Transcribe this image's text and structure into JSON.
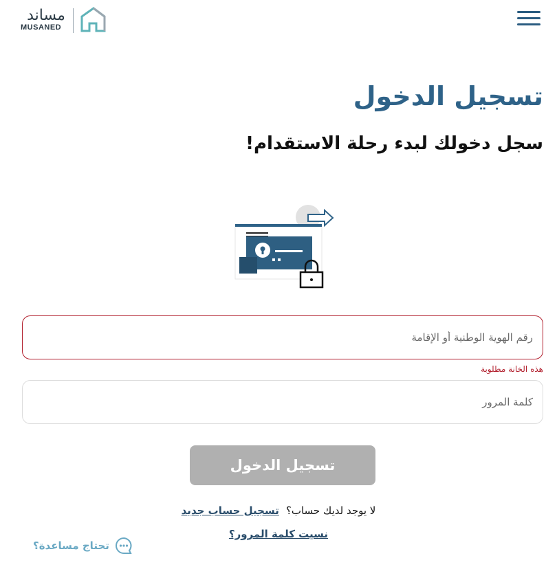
{
  "header": {
    "logo_ar": "مساند",
    "logo_en": "MUSANED"
  },
  "login": {
    "title": "تسجيل الدخول",
    "subtitle": "سجل دخولك لبدء رحلة الاستقدام!",
    "id_placeholder": "رقم الهوية الوطنية أو الإقامة",
    "id_value": "",
    "id_error": "هذه الخانة مطلوبة",
    "password_placeholder": "كلمة المرور",
    "password_value": "",
    "submit_label": "تسجيل الدخول",
    "no_account_text": "لا يوجد لديك حساب؟",
    "register_link": "تسجيل حساب جديد",
    "forgot_link": "نسيت كلمة المرور؟"
  },
  "help": {
    "label": "تحتاج مساعدة؟",
    "icon": "chat-bubble-icon"
  },
  "colors": {
    "primary": "#2e6288",
    "error": "#b21f2d",
    "button_disabled": "#b0b0b0",
    "help": "#6aa9c4"
  }
}
